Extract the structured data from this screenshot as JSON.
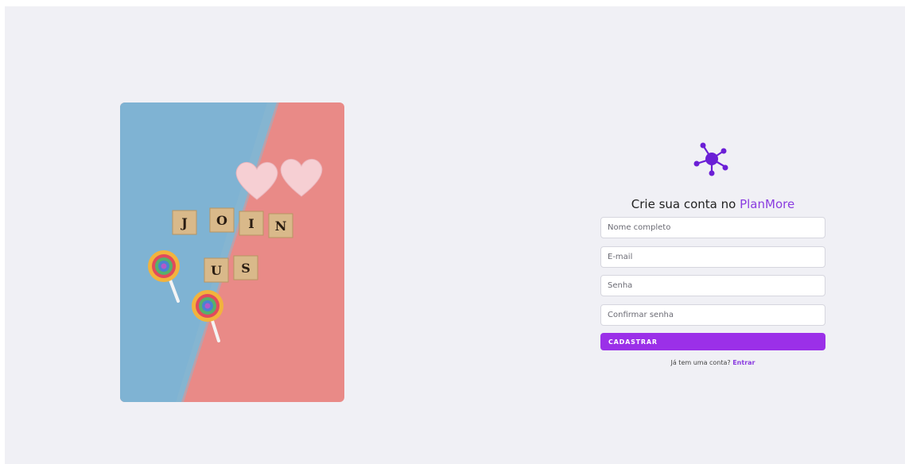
{
  "illustration": {
    "tiles_row1": [
      "J",
      "O",
      "I",
      "N"
    ],
    "tiles_row2": [
      "U",
      "S"
    ]
  },
  "signup": {
    "heading_prefix": "Crie sua conta no ",
    "brand_name": "PlanMore",
    "fields": {
      "name_placeholder": "Nome completo",
      "email_placeholder": "E-mail",
      "password_placeholder": "Senha",
      "confirm_placeholder": "Confirmar senha"
    },
    "submit_label": "CADASTRAR",
    "login_prompt": "Já tem uma conta?",
    "login_link": "Entrar"
  },
  "colors": {
    "accent": "#9b30e8",
    "brand_text": "#8a3ce0",
    "logo": "#6b1fd6",
    "background": "#f0f0f5"
  },
  "icons": {
    "logo": "network-molecule-icon"
  }
}
